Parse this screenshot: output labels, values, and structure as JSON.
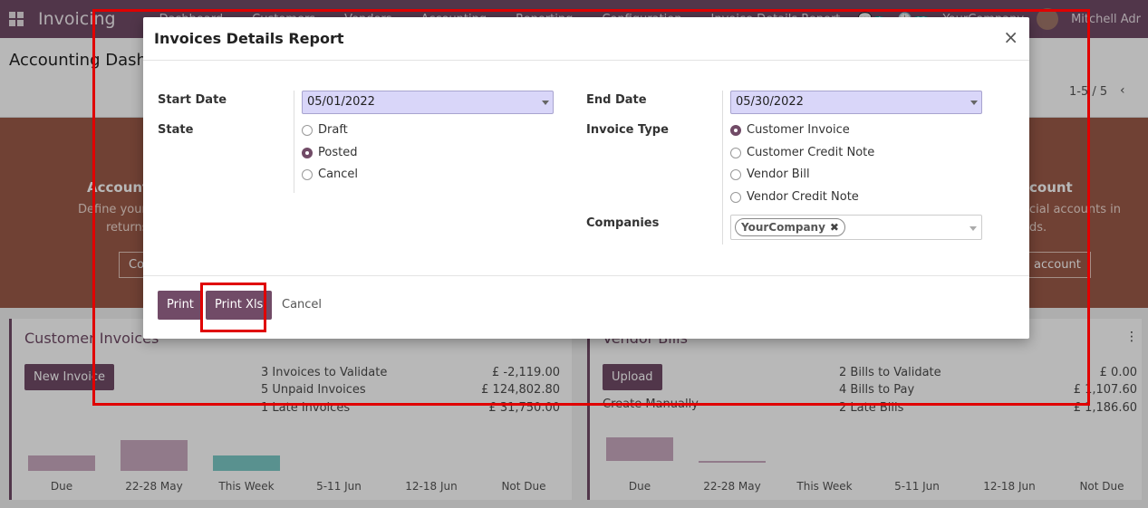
{
  "navbar": {
    "brand": "Invoicing",
    "menu": [
      "Dashboard",
      "Customers",
      "Vendors",
      "Accounting",
      "Reporting",
      "Configuration",
      "Invoice Details Report"
    ],
    "badge_chat": "4",
    "badge_activity": "12",
    "company": "YourCompany",
    "user": "Mitchell Adr"
  },
  "control": {
    "title": "Accounting Dashbo",
    "pager": "1-5 / 5",
    "prev": "‹"
  },
  "banner": {
    "left_title": "Account",
    "left_text1": "Define your t",
    "left_text2": "returns",
    "left_button": "Co",
    "right_title": "count",
    "right_text1": "cial accounts in",
    "right_text2": "ds.",
    "right_button": "account"
  },
  "customer_card": {
    "title": "Customer Invoices",
    "button": "New Invoice",
    "stats": [
      {
        "label": "3 Invoices to Validate",
        "amount": "£ -2,119.00"
      },
      {
        "label": "5 Unpaid Invoices",
        "amount": "£ 124,802.80"
      },
      {
        "label": "1 Late Invoices",
        "amount": "£ 31,750.00"
      }
    ],
    "chart_labels": [
      "Due",
      "22-28 May",
      "This Week",
      "5-11 Jun",
      "12-18 Jun",
      "Not Due"
    ]
  },
  "vendor_card": {
    "title": "Vendor Bills",
    "button": "Upload",
    "manual": "Create Manually",
    "kebab": "⋮",
    "stats": [
      {
        "label": "2 Bills to Validate",
        "amount": "£ 0.00"
      },
      {
        "label": "4 Bills to Pay",
        "amount": "£ 1,107.60"
      },
      {
        "label": "2 Late Bills",
        "amount": "£ 1,186.60"
      }
    ],
    "chart_labels": [
      "Due",
      "22-28 May",
      "This Week",
      "5-11 Jun",
      "12-18 Jun",
      "Not Due"
    ]
  },
  "modal": {
    "title": "Invoices Details Report",
    "close": "×",
    "start_date_label": "Start Date",
    "start_date": "05/01/2022",
    "end_date_label": "End Date",
    "end_date": "05/30/2022",
    "state_label": "State",
    "state_options": [
      {
        "label": "Draft",
        "checked": false
      },
      {
        "label": "Posted",
        "checked": true
      },
      {
        "label": "Cancel",
        "checked": false
      }
    ],
    "invoice_type_label": "Invoice Type",
    "invoice_type_options": [
      {
        "label": "Customer Invoice",
        "checked": true
      },
      {
        "label": "Customer Credit Note",
        "checked": false
      },
      {
        "label": "Vendor Bill",
        "checked": false
      },
      {
        "label": "Vendor Credit Note",
        "checked": false
      }
    ],
    "companies_label": "Companies",
    "company_tag": "YourCompany",
    "tag_remove": "✖",
    "print": "Print",
    "print_xls": "Print Xls",
    "cancel": "Cancel"
  },
  "colors": {
    "brand": "#714b67",
    "highlight": "#e00000",
    "date_bg": "#d9d6f9"
  }
}
